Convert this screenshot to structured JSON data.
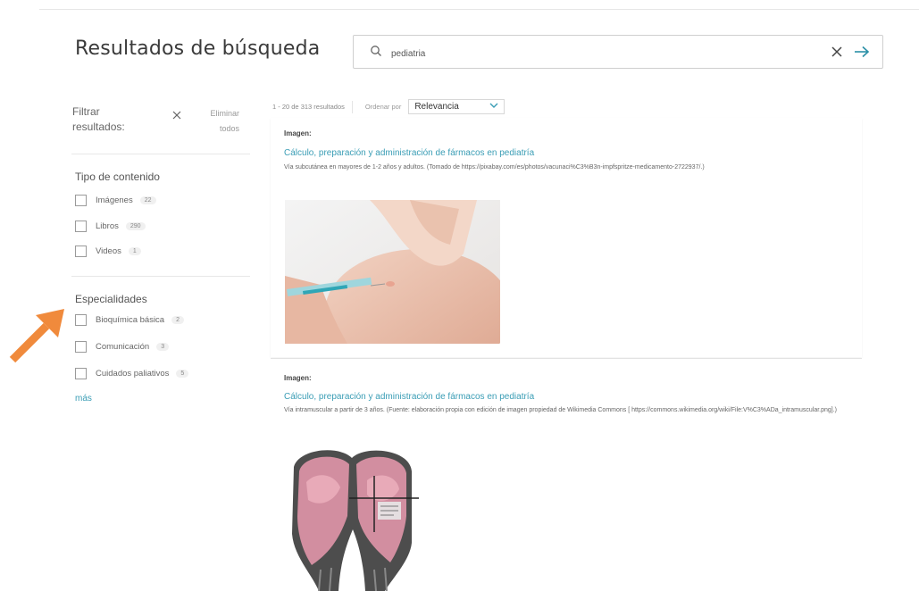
{
  "header": {
    "title": "Resultados de búsqueda",
    "search_value": "pediatria"
  },
  "sidebar": {
    "filter_title": "Filtrar resultados:",
    "clear_all": "Eliminar todos",
    "content_type": {
      "title": "Tipo de contenido",
      "items": [
        {
          "label": "Imágenes",
          "count": "22"
        },
        {
          "label": "Libros",
          "count": "290"
        },
        {
          "label": "Videos",
          "count": "1"
        }
      ]
    },
    "specialties": {
      "title": "Especialidades",
      "items": [
        {
          "label": "Bioquímica básica",
          "count": "2"
        },
        {
          "label": "Comunicación",
          "count": "3"
        },
        {
          "label": "Cuidados paliativos",
          "count": "5"
        }
      ]
    },
    "more": "más"
  },
  "results": {
    "summary": "1 - 20 de 313 resultados",
    "order_label": "Ordenar por",
    "order_value": "Relevancia",
    "items": [
      {
        "type": "Imagen:",
        "title": "Cálculo, preparación y administración de fármacos en pediatría",
        "description": "Vía subcutánea en mayores de 1-2 años y adultos. (Tomado de https://pixabay.com/es/photos/vacunaci%C3%B3n-impfspritze-medicamento-2722937/.)"
      },
      {
        "type": "Imagen:",
        "title": "Cálculo, preparación y administración de fármacos en pediatría",
        "description": "Vía intramuscular a partir de 3 años. (Fuente: elaboración propia con edición de imagen propiedad de Wikimedia Commons [ https://commons.wikimedia.org/wiki/File:V%C3%ADa_intramuscular.png].)"
      }
    ]
  },
  "colors": {
    "link": "#3a9db5",
    "annotation_arrow": "#f08a3c"
  }
}
